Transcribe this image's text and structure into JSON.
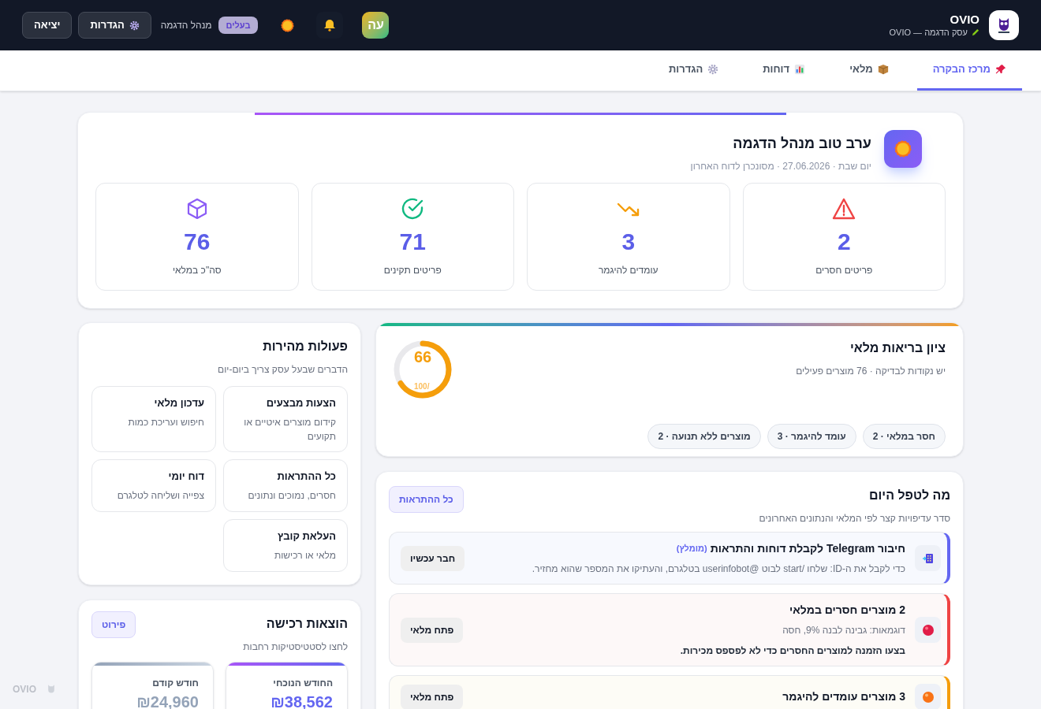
{
  "header": {
    "brand": "OVIO",
    "business": "עסק הדגמה — OVIO",
    "avatar_letters": "עה",
    "role_badge": "בעלים",
    "user_name": "מנהל הדגמה",
    "settings_button": "הגדרות",
    "logout_button": "יציאה"
  },
  "tabs": [
    {
      "label": "מרכז הבקרה",
      "selected": true
    },
    {
      "label": "מלאי",
      "selected": false
    },
    {
      "label": "דוחות",
      "selected": false
    },
    {
      "label": "הגדרות",
      "selected": false
    }
  ],
  "greeting": {
    "title": "ערב טוב מנהל הדגמה",
    "subtitle": "יום שבת · 27.06.2026 · מסונכרן לדוח האחרון"
  },
  "stats": [
    {
      "value": "2",
      "label": "פריטים חסרים",
      "kind": "alert"
    },
    {
      "value": "3",
      "label": "עומדים להיגמר",
      "kind": "trend"
    },
    {
      "value": "71",
      "label": "פריטים תקינים",
      "kind": "ok"
    },
    {
      "value": "76",
      "label": "סה\"כ במלאי",
      "kind": "box"
    }
  ],
  "health": {
    "title": "ציון בריאות מלאי",
    "subtitle": "יש נקודות לבדיקה · 76 מוצרים פעילים",
    "score": "66",
    "max": "/100",
    "level": 0.66,
    "chips": [
      "חסר במלאי · 2",
      "עומד להיגמר · 3",
      "מוצרים ללא תנועה · 2"
    ]
  },
  "today": {
    "title": "מה לטפל היום",
    "subtitle": "סדר עדיפויות קצר לפי המלאי והנתונים האחרונים",
    "button": "כל ההתראות",
    "items": [
      {
        "kind": "info",
        "title": "חיבור Telegram לקבלת דוחות והתראות",
        "tag": "(מומלץ)",
        "text": "כדי לקבל את ה-ID: שלחו /start לבוט @userinfobot בטלגרם, והעתיקו את המספר שהוא מחזיר.",
        "button": "חבר עכשיו"
      },
      {
        "kind": "danger",
        "title": "2 מוצרים חסרים במלאי",
        "text": "דוגמאות: גבינה לבנה 9%, חסה",
        "note": "בצעו הזמנה למוצרים החסרים כדי לא לפספס מכירות.",
        "button": "פתח מלאי"
      },
      {
        "kind": "warning",
        "title": "3 מוצרים עומדים להיגמר",
        "button": "פתח מלאי"
      }
    ]
  },
  "quick_actions": {
    "title": "פעולות מהירות",
    "subtitle": "הדברים שבעל עסק צריך ביום-יום",
    "actions": [
      {
        "title": "הצעות מבצעים",
        "text": "קידום מוצרים איטיים או תקועים"
      },
      {
        "title": "עדכון מלאי",
        "text": "חיפוש ועריכת כמות"
      },
      {
        "title": "כל ההתראות",
        "text": "חסרים, נמוכים ונתונים"
      },
      {
        "title": "דוח יומי",
        "text": "צפייה ושליחה לטלגרם"
      },
      {
        "title": "העלאת קובץ",
        "text": "מלאי או רכישות"
      }
    ]
  },
  "purchases": {
    "title": "הוצאות רכישה",
    "subtitle": "לחצו לסטטיסטיקות רחבות",
    "button": "פירוט",
    "months": [
      {
        "kind": "current",
        "label": "החודש הנוכחי",
        "value": "₪38,562"
      },
      {
        "kind": "previous",
        "label": "חודש קודם",
        "value": "₪24,960"
      }
    ]
  },
  "corner_brand": "OVIO"
}
